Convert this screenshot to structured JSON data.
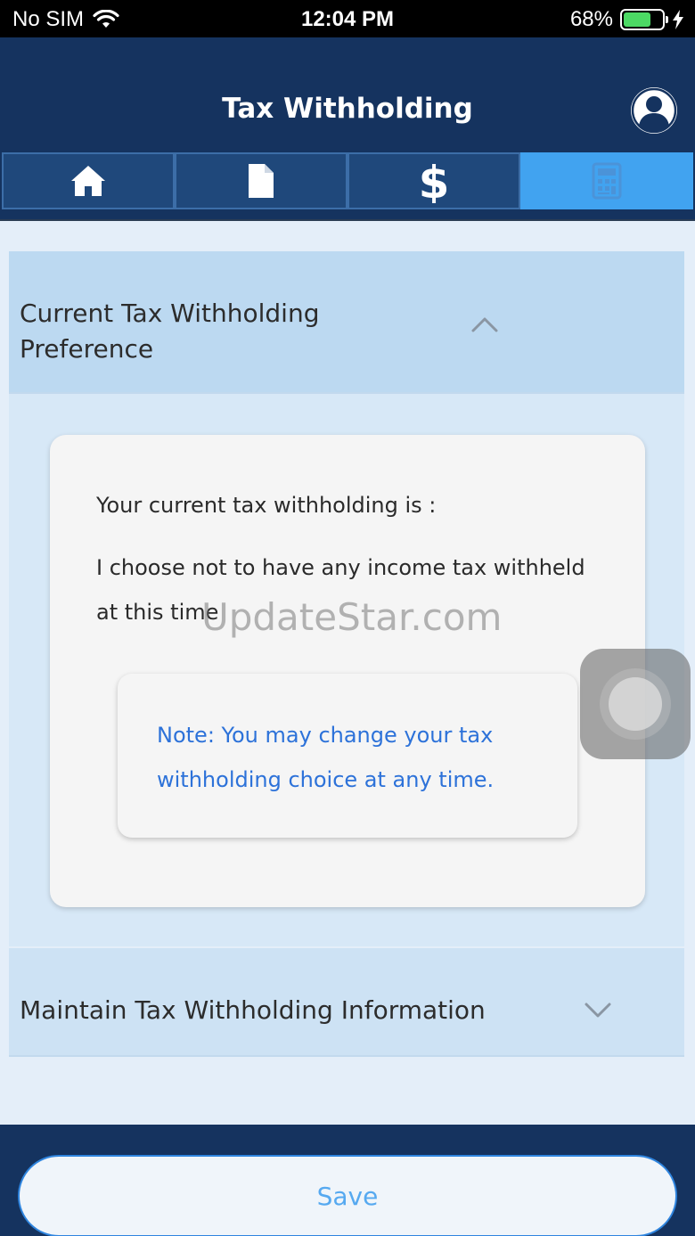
{
  "status_bar": {
    "carrier": "No SIM",
    "time": "12:04 PM",
    "battery": "68%",
    "battery_level": 0.68
  },
  "header": {
    "title": "Tax Withholding"
  },
  "tabs": [
    {
      "icon": "home-icon"
    },
    {
      "icon": "document-icon"
    },
    {
      "icon": "dollar-icon"
    },
    {
      "icon": "calculator-icon",
      "active": true
    }
  ],
  "sections": {
    "current": {
      "title_line1": "Current Tax Withholding",
      "title_line2": "Preference",
      "expanded": true
    },
    "maintain": {
      "title": "Maintain Tax Withholding Information",
      "expanded": false
    }
  },
  "card": {
    "intro": "Your current tax withholding is :",
    "choice_line1": "I choose not to have any income tax withheld",
    "choice_line2": "at this time",
    "note_line1": "Note: You may change your tax",
    "note_line2": "withholding choice at any time."
  },
  "watermark": "UpdateStar.com",
  "footer": {
    "save_label": "Save"
  },
  "colors": {
    "navy": "#15335f",
    "accent": "#41a3f0",
    "note_text": "#2d72d9"
  }
}
